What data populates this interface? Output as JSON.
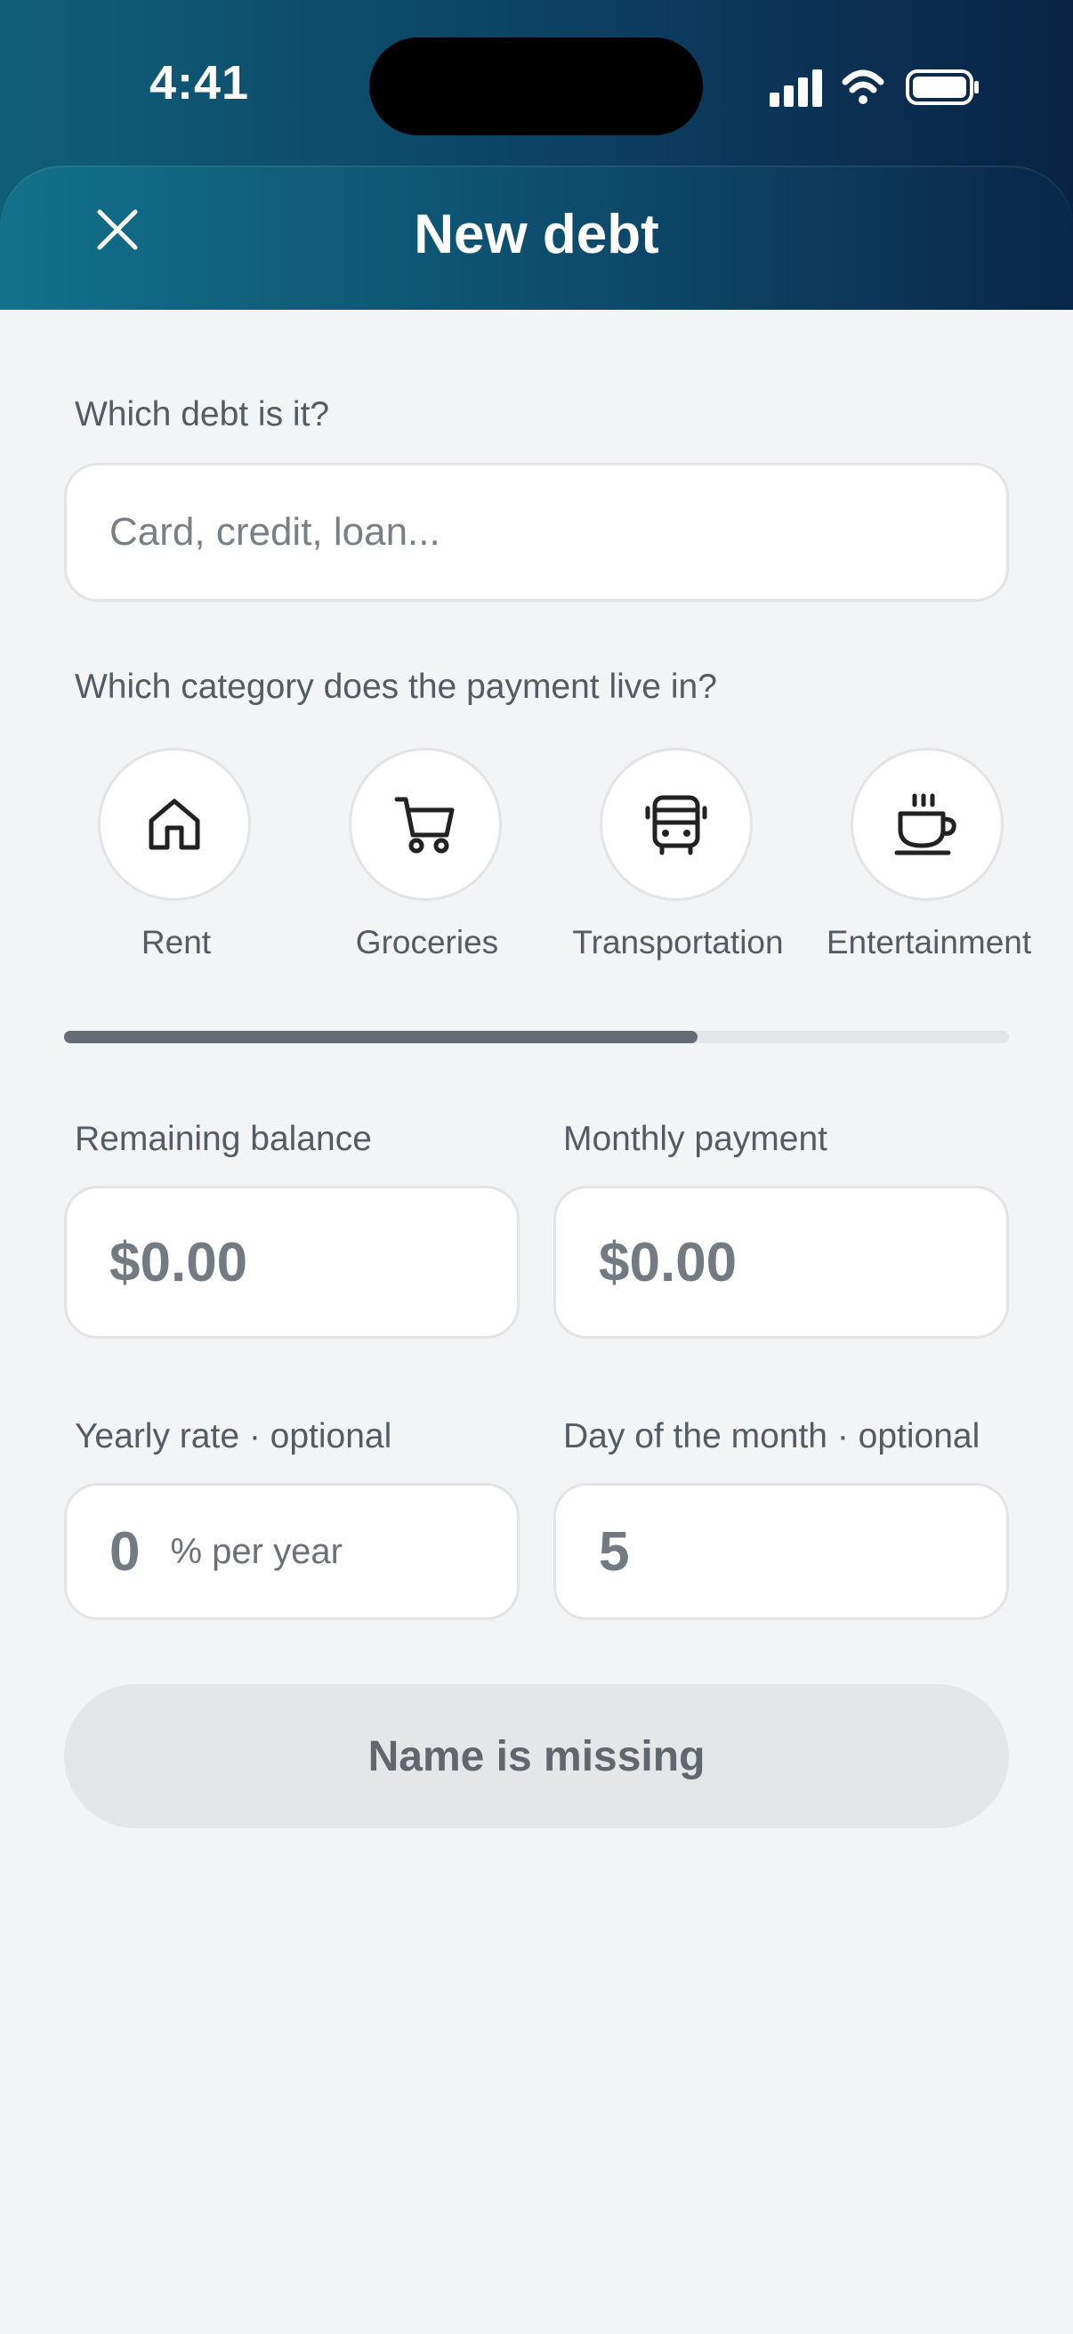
{
  "status_bar": {
    "time": "4:41"
  },
  "header": {
    "title": "New debt",
    "close_icon": "close-icon"
  },
  "debt_name": {
    "label": "Which debt is it?",
    "placeholder": "Card, credit, loan..."
  },
  "category": {
    "label": "Which category does the payment live in?",
    "items": [
      {
        "label": "Rent",
        "icon": "house-icon"
      },
      {
        "label": "Groceries",
        "icon": "shopping-cart-icon"
      },
      {
        "label": "Transportation",
        "icon": "bus-icon"
      },
      {
        "label": "Entertainment",
        "icon": "coffee-cup-icon"
      }
    ],
    "scroll_progress": 0.67
  },
  "balance": {
    "label": "Remaining balance",
    "value": "$0.00"
  },
  "monthly": {
    "label": "Monthly payment",
    "value": "$0.00"
  },
  "rate": {
    "label": "Yearly rate · optional",
    "value": "0",
    "suffix": "% per year"
  },
  "day": {
    "label": "Day of the month · optional",
    "value": "5"
  },
  "submit": {
    "label": "Name is missing"
  },
  "colors": {
    "header_start": "#12718b",
    "header_end": "#0a2748",
    "background": "#f3f4f6",
    "button_disabled": "#e5e6e8"
  }
}
